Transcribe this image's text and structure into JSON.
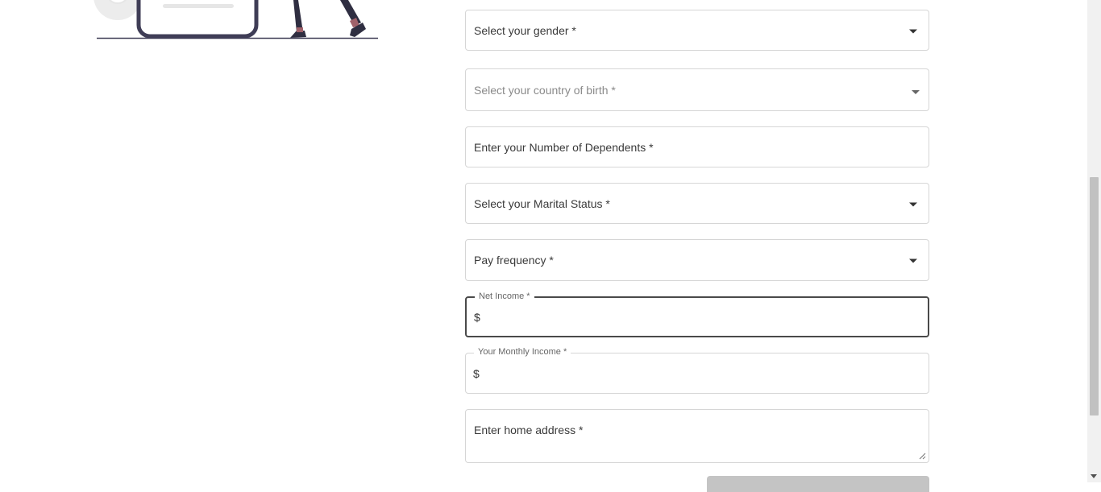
{
  "form": {
    "gender": {
      "label": "Select your gender *",
      "icon": "chevron-down-icon"
    },
    "country_of_birth": {
      "label": "Select your country of birth *",
      "icon": "chevron-down-icon"
    },
    "dependents": {
      "label": "Enter your Number of Dependents *"
    },
    "marital_status": {
      "label": "Select your Marital Status *",
      "icon": "chevron-down-icon"
    },
    "pay_frequency": {
      "label": "Pay frequency *",
      "icon": "chevron-down-icon"
    },
    "net_income": {
      "label": "Net Income *",
      "prefix": "$",
      "value": ""
    },
    "monthly_income": {
      "label": "Your Monthly Income *",
      "prefix": "$",
      "value": ""
    },
    "home_address": {
      "label": "Enter home address *"
    }
  },
  "colors": {
    "border": "#d6d6d6",
    "focused_border": "#4a4a4a",
    "button_disabled": "#c4c4c4",
    "illustration_dark": "#3f3d56"
  }
}
